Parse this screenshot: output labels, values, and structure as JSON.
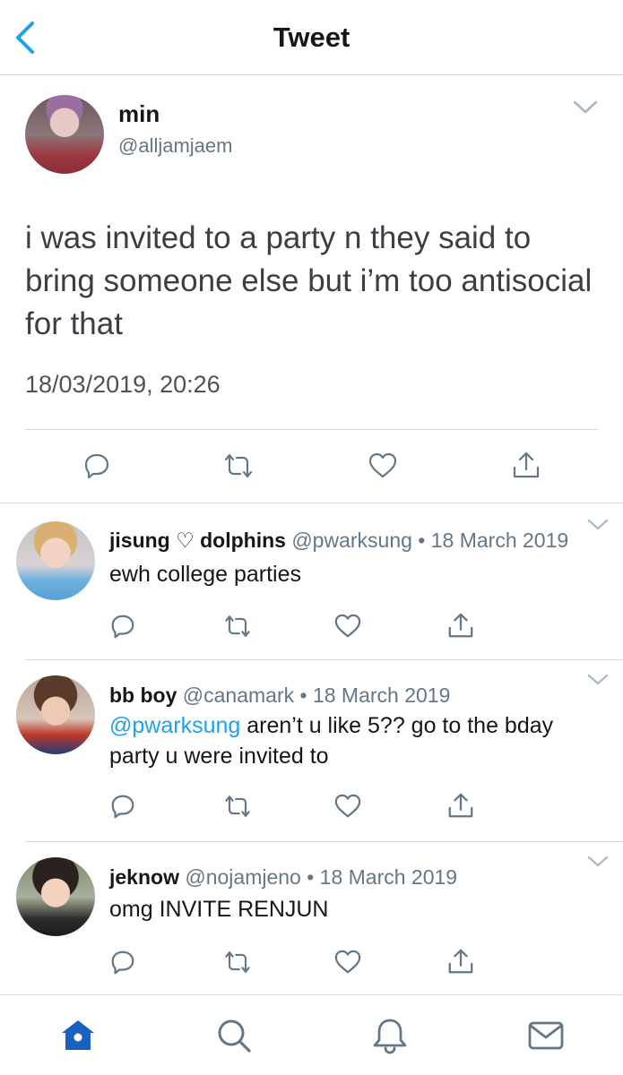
{
  "header": {
    "title": "Tweet",
    "back_icon": "chevron-left-icon"
  },
  "tweet": {
    "name": "min",
    "handle": "@alljamjaem",
    "text": "i was invited to a party n they said to bring someone else but i’m too antisocial for that",
    "timestamp": "18/03/2019, 20:26"
  },
  "replies": [
    {
      "name": "jisung ♡ dolphins",
      "meta": "@pwarksung • 18 March 2019",
      "mention": "",
      "text": "ewh college parties"
    },
    {
      "name": "bb boy",
      "meta": "@canamark • 18 March 2019",
      "mention": "@pwarksung",
      "text": " aren’t u like 5?? go to the bday party u were invited to"
    },
    {
      "name": "jeknow",
      "meta": "@nojamjeno • 18 March 2019",
      "mention": "",
      "text": "omg INVITE RENJUN"
    }
  ],
  "colors": {
    "accent": "#1da1f2",
    "icon": "#657786",
    "tab_active": "#1b5fc1",
    "divider": "#d6dadd"
  },
  "tabbar": {
    "items": [
      "home-icon",
      "search-icon",
      "notifications-icon",
      "messages-icon"
    ],
    "active": "home-icon"
  }
}
